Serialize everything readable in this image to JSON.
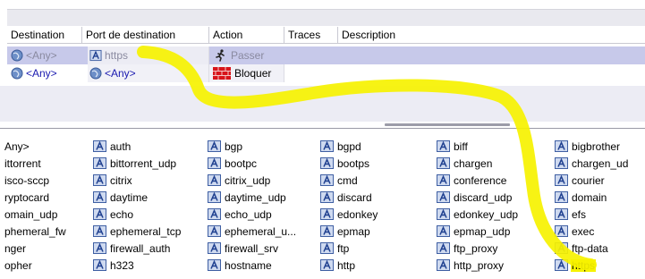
{
  "columns": [
    "Destination",
    "Port de destination",
    "Action",
    "Traces",
    "Description"
  ],
  "rules": [
    {
      "destination": "<Any>",
      "port": "https",
      "action": "Passer",
      "selected": true
    },
    {
      "destination": "<Any>",
      "port": "<Any>",
      "action": "Bloquer",
      "selected": false
    }
  ],
  "services": [
    [
      "Any>",
      "ittorrent",
      "isco-sccp",
      "ryptocard",
      "omain_udp",
      "phemeral_fw",
      "nger",
      "opher"
    ],
    [
      "auth",
      "bittorrent_udp",
      "citrix",
      "daytime",
      "echo",
      "ephemeral_tcp",
      "firewall_auth",
      "h323"
    ],
    [
      "bgp",
      "bootpc",
      "citrix_udp",
      "daytime_udp",
      "echo_udp",
      "ephemeral_u...",
      "firewall_srv",
      "hostname"
    ],
    [
      "bgpd",
      "bootps",
      "cmd",
      "discard",
      "edonkey",
      "epmap",
      "ftp",
      "http"
    ],
    [
      "biff",
      "chargen",
      "conference",
      "discard_udp",
      "edonkey_udp",
      "epmap_udp",
      "ftp_proxy",
      "http_proxy"
    ],
    [
      "bigbrother",
      "chargen_ud",
      "courier",
      "domain",
      "efs",
      "exec",
      "ftp-data",
      "https"
    ]
  ],
  "selected_service": "https",
  "colors": {
    "selection": "#c7c9ea",
    "highlight": "#f6f200",
    "link": "#1a1ab0"
  },
  "icons": [
    "globe-icon",
    "port-object-icon",
    "runner-icon",
    "brick-wall-icon"
  ]
}
